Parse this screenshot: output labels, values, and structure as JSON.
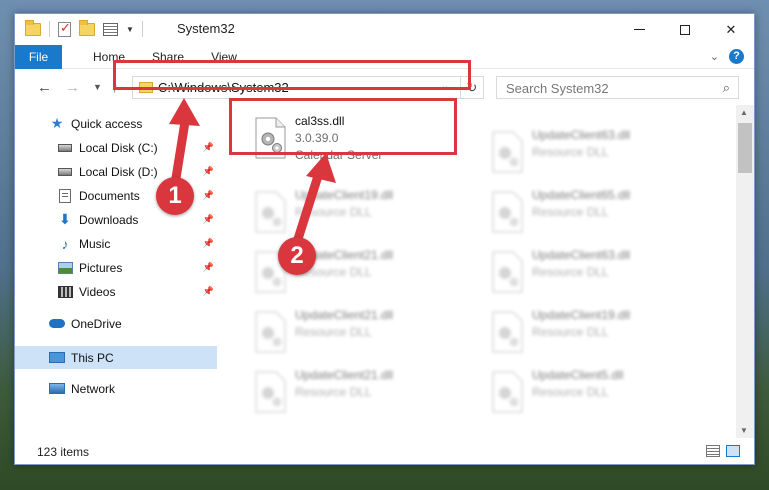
{
  "window": {
    "title": "System32"
  },
  "ribbon": {
    "tabs": [
      "File",
      "Home",
      "Share",
      "View"
    ]
  },
  "address": {
    "path": "C:\\Windows\\System32"
  },
  "search": {
    "placeholder": "Search System32"
  },
  "sidebar": {
    "items": [
      {
        "label": "Quick access",
        "icon": "star-icon"
      },
      {
        "label": "Local Disk (C:)",
        "icon": "disk-icon",
        "pinned": true
      },
      {
        "label": "Local Disk (D:)",
        "icon": "disk-icon",
        "pinned": true
      },
      {
        "label": "Documents",
        "icon": "documents-icon",
        "pinned": true
      },
      {
        "label": "Downloads",
        "icon": "downloads-icon",
        "pinned": true
      },
      {
        "label": "Music",
        "icon": "music-icon",
        "pinned": true
      },
      {
        "label": "Pictures",
        "icon": "pictures-icon",
        "pinned": true
      },
      {
        "label": "Videos",
        "icon": "videos-icon",
        "pinned": true
      },
      {
        "label": "OneDrive",
        "icon": "onedrive-icon"
      },
      {
        "label": "This PC",
        "icon": "computer-icon",
        "selected": true
      },
      {
        "label": "Network",
        "icon": "network-icon"
      }
    ]
  },
  "files": {
    "featured": {
      "name": "cal3ss.dll",
      "version": "3.0.39.0",
      "description": "Calendar Server"
    },
    "blurred": [
      {
        "name": "UpdateClient63.dll",
        "type": "Resource DLL"
      },
      {
        "name": "UpdateClient19.dll",
        "type": "Resource DLL"
      },
      {
        "name": "UpdateClient65.dll",
        "type": "Resource DLL"
      },
      {
        "name": "UpdateClient21.dll",
        "type": "Resource DLL"
      },
      {
        "name": "UpdateClient63.dll",
        "type": "Resource DLL"
      },
      {
        "name": "UpdateClient21.dll",
        "type": "Resource DLL"
      },
      {
        "name": "UpdateClient19.dll",
        "type": "Resource DLL"
      },
      {
        "name": "UpdateClient21.dll",
        "type": "Resource DLL"
      },
      {
        "name": "UpdateClient5.dll",
        "type": "Resource DLL"
      }
    ]
  },
  "status": {
    "item_count": "123 items"
  },
  "annotations": {
    "step1": "1",
    "step2": "2",
    "color": "#d9363e"
  }
}
